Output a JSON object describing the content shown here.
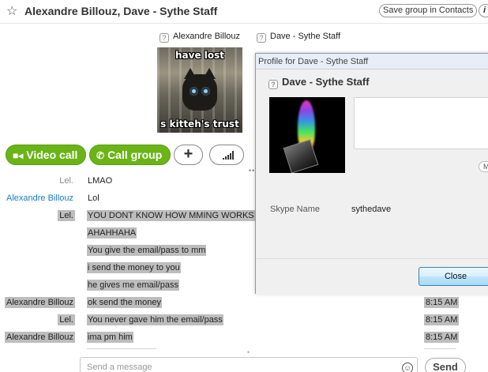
{
  "header": {
    "title": "Alexandre Billouz, Dave - Sythe Staff",
    "save_group_label": "Save group in Contacts",
    "info_label": "i"
  },
  "participants": [
    {
      "name": "Alexandre Billouz"
    },
    {
      "name": "Dave - Sythe Staff"
    }
  ],
  "avatar_caption": {
    "top": "have lost",
    "bottom": "s kitteh's trust"
  },
  "call_bar": {
    "video_call": "Video call",
    "call_group": "Call group",
    "add": "+"
  },
  "messages": [
    {
      "sender": "Lel.",
      "text": "LMAO",
      "time": ""
    },
    {
      "sender": "Alexandre Billouz",
      "text": "Lol",
      "time": ""
    },
    {
      "sender": "Lel.",
      "text": "YOU DONT KNOW HOW MMING WORKS",
      "time": ""
    },
    {
      "sender": "",
      "text": "AHAHHAHA",
      "time": ""
    },
    {
      "sender": "",
      "text": "You give the email/pass to mm",
      "time": ""
    },
    {
      "sender": "",
      "text": "i send the money to you",
      "time": ""
    },
    {
      "sender": "",
      "text": "he gives me email/pass",
      "time": ""
    },
    {
      "sender": "Alexandre Billouz",
      "text": "ok send the money",
      "time": "8:15 AM"
    },
    {
      "sender": "Lel.",
      "text": "You never gave him the email/pass",
      "time": "8:15 AM"
    },
    {
      "sender": "Alexandre Billouz",
      "text": "ima pm him",
      "time": "8:15 AM"
    }
  ],
  "composer": {
    "placeholder": "Send a message",
    "send_label": "Send"
  },
  "profile_dialog": {
    "title": "Profile for Dave - Sythe Staff",
    "name": "Dave - Sythe Staff",
    "skype_name_label": "Skype Name",
    "skype_name_value": "sythedave",
    "mini_button_label": "M",
    "close_label": "Close"
  },
  "colors": {
    "accent_green": "#6ab417",
    "link_blue": "#1a7bc4",
    "selection_gray": "#bdbdbd"
  },
  "icons": [
    "star-icon",
    "status-icon",
    "phone-icon",
    "video-camera-icon",
    "plus-icon",
    "signal-icon",
    "emoji-icon"
  ]
}
